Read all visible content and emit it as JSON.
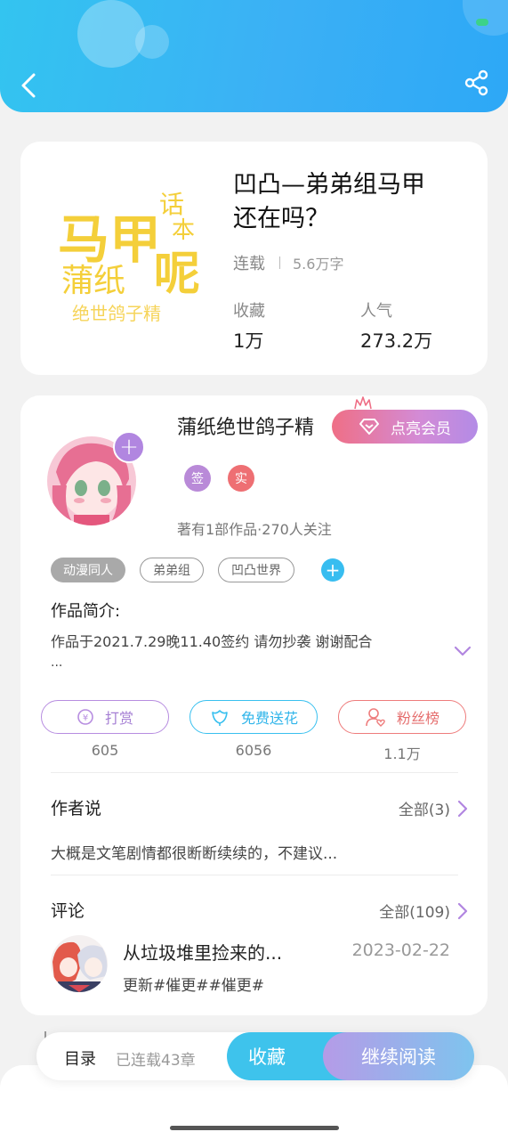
{
  "header": {
    "back_icon": "chevron-left-icon",
    "share_icon": "share-icon"
  },
  "book": {
    "cover_text": {
      "line1": "马甲",
      "line2": "话",
      "line3": "本",
      "line4": "呢",
      "line5": "蒲纸",
      "line6": "绝世鸽子精"
    },
    "title_line1": "凹凸—弟弟组马甲",
    "title_line2": "还在吗？",
    "status": "连载",
    "word_count": "5.6万字",
    "favorites_label": "收藏",
    "favorites_value": "1万",
    "popularity_label": "人气",
    "popularity_value": "273.2万"
  },
  "author": {
    "name": "蒲纸绝世鸽子精",
    "vip_button": "点亮会员",
    "badge_sign": "签",
    "badge_real": "实",
    "meta": "著有1部作品·270人关注"
  },
  "tags": [
    "动漫同人",
    "弟弟组",
    "凹凸世界"
  ],
  "intro": {
    "title": "作品简介:",
    "text": "作品于2021.7.29晚11.40签约 请勿抄袭 谢谢配合",
    "ellipsis": "..."
  },
  "actions": [
    {
      "label": "打赏",
      "count": "605",
      "icon": "coin-icon"
    },
    {
      "label": "免费送花",
      "count": "6056",
      "icon": "flower-icon"
    },
    {
      "label": "粉丝榜",
      "count": "1.1万",
      "icon": "fan-rank-icon"
    }
  ],
  "author_says": {
    "title": "作者说",
    "more": "全部(3)",
    "text": "大概是文笔剧情都很断断续续的，不建议..."
  },
  "comments": {
    "title": "评论",
    "more": "全部(109)",
    "item": {
      "title": "从垃圾堆里捡来的...",
      "date": "2023-02-22",
      "text": "更新#催更##催更#"
    }
  },
  "bottom_bar": {
    "toc": "目录",
    "chapters": "已连载43章",
    "favorite": "收藏",
    "continue": "继续阅读"
  },
  "colors": {
    "header": "#33c4f0",
    "accent_blue": "#3ec3ec",
    "accent_purple": "#b186e0",
    "accent_red": "#ee6f73"
  }
}
